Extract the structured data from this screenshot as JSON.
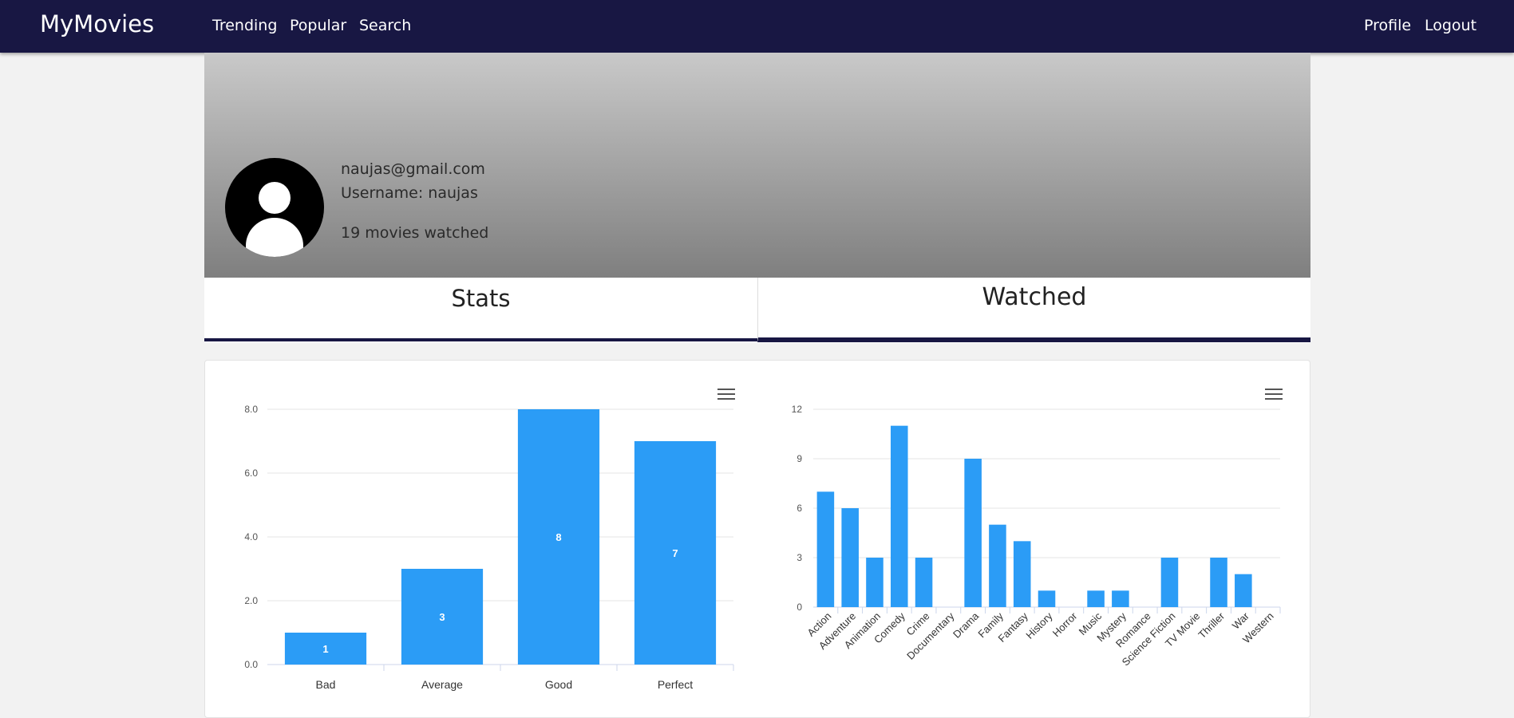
{
  "nav": {
    "brand": "MyMovies",
    "links": [
      "Trending",
      "Popular",
      "Search"
    ],
    "right_links": [
      "Profile",
      "Logout"
    ]
  },
  "profile": {
    "email": "naujas@gmail.com",
    "username": "Username: naujas",
    "watched_count": "19 movies watched"
  },
  "tabs": [
    "Stats",
    "Watched"
  ],
  "colors": {
    "navbar": "#181743",
    "bar": "#2b9cf6",
    "tab_underline": "#181743"
  },
  "icons": {
    "chart_menu": "hamburger-menu-icon",
    "avatar": "user-silhouette-icon"
  },
  "chart_data": [
    {
      "type": "bar",
      "categories": [
        "Bad",
        "Average",
        "Good",
        "Perfect"
      ],
      "values": [
        1,
        3,
        8,
        7
      ],
      "yticks": [
        "0.0",
        "2.0",
        "4.0",
        "6.0",
        "8.0"
      ],
      "ylim": [
        0,
        8
      ],
      "data_labels": true,
      "grid": true
    },
    {
      "type": "bar",
      "categories": [
        "Action",
        "Adventure",
        "Animation",
        "Comedy",
        "Crime",
        "Documentary",
        "Drama",
        "Family",
        "Fantasy",
        "History",
        "Horror",
        "Music",
        "Mystery",
        "Romance",
        "Science Fiction",
        "TV Movie",
        "Thriller",
        "War",
        "Western"
      ],
      "values": [
        7,
        6,
        3,
        11,
        3,
        0,
        9,
        5,
        4,
        1,
        0,
        1,
        1,
        0,
        3,
        0,
        3,
        2,
        0
      ],
      "yticks": [
        "0",
        "3",
        "6",
        "9",
        "12"
      ],
      "ylim": [
        0,
        12
      ],
      "data_labels": false,
      "grid": true
    }
  ]
}
